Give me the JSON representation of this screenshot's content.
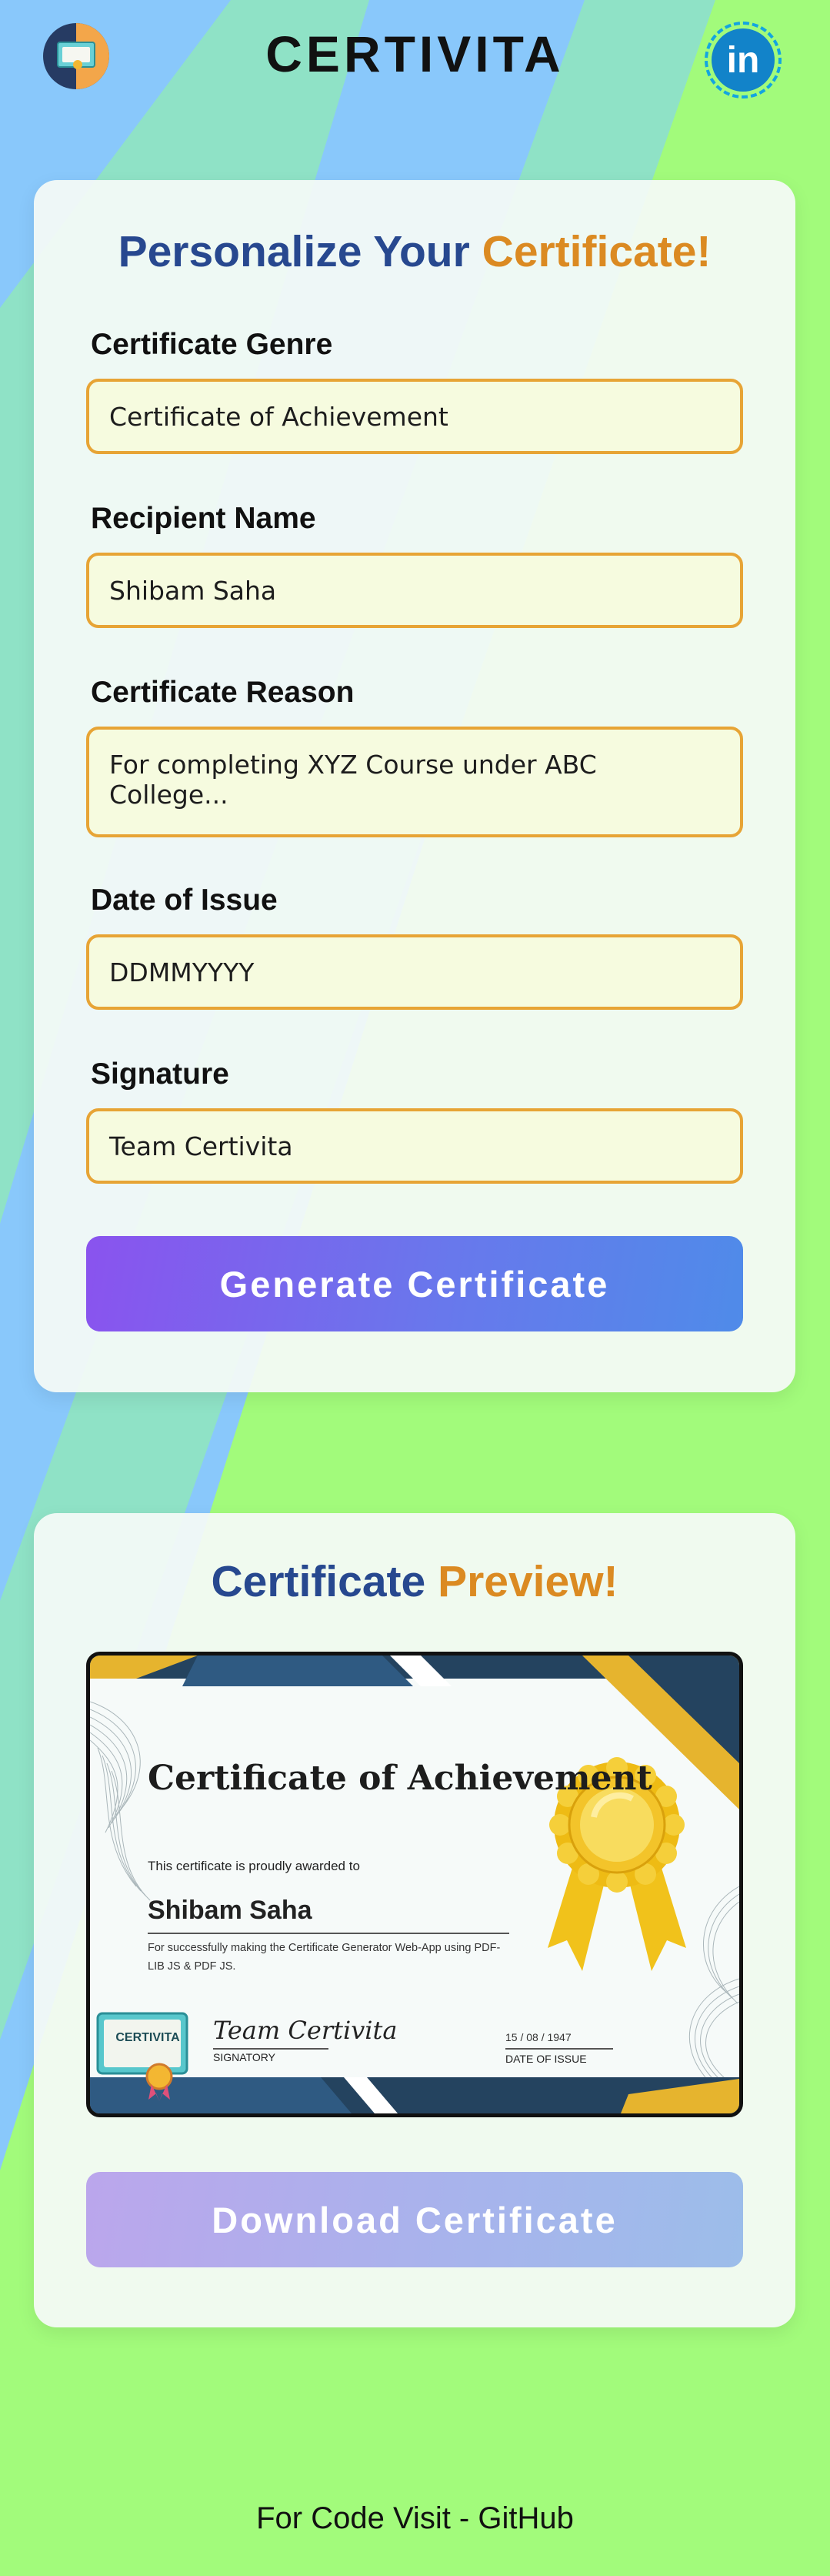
{
  "app": {
    "brand": "CERTIVITA",
    "logo_icon": "certificate-logo-icon",
    "social_icon": "linkedin-icon",
    "social_icon_glyph": "in"
  },
  "form": {
    "title_part1": "Personalize Your",
    "title_part2": "Certificate!",
    "fields": [
      {
        "label": "Certificate Genre",
        "value": "Certificate of Achievement"
      },
      {
        "label": "Recipient Name",
        "value": "Shibam Saha"
      },
      {
        "label": "Certificate Reason",
        "value": "For completing XYZ Course under ABC College..."
      },
      {
        "label": "Date of Issue",
        "value": "DDMMYYYY"
      },
      {
        "label": "Signature",
        "value": "Team Certivita"
      }
    ],
    "generate_label": "Generate Certificate"
  },
  "preview": {
    "title_part1": "Certificate",
    "title_part2": "Preview!",
    "certificate": {
      "title": "Certificate of Achievement",
      "awarded_text": "This certificate is proudly awarded to",
      "recipient": "Shibam Saha",
      "reason": "For successfully making the Certificate Generator Web-App using PDF-LIB JS & PDF JS.",
      "signature": "Team Certivita",
      "signatory_label": "SIGNATORY",
      "date": "15 / 08 / 1947",
      "date_label": "DATE OF ISSUE",
      "stamp_text": "CERTIVITA"
    },
    "download_label": "Download Certificate"
  },
  "footer": {
    "text": "For Code Visit - GitHub"
  },
  "colors": {
    "title_blue": "#27488f",
    "title_orange": "#db8a22",
    "field_border": "#e7a435",
    "field_bg": "#f6fbdf",
    "bg_green": "#a2fb7b",
    "bg_blue": "#89c8fb",
    "bg_teal": "#8fe2c6"
  }
}
